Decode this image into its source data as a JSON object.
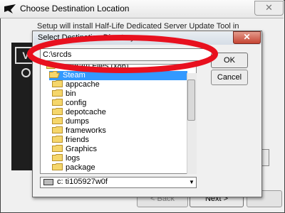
{
  "outer_window": {
    "title": "Choose Destination Location",
    "close_glyph": "✕",
    "subtitle_fragment": "Setup will install Half-Life Dedicated Server Update Tool in",
    "left_panel_glyph": "V",
    "buttons": {
      "back": "< Back",
      "next": "Next >",
      "cancel": ""
    }
  },
  "dialog": {
    "title": "Select Destination Directory",
    "close_glyph": "✕",
    "path_value": "C:\\srcds",
    "ok_label": "OK",
    "cancel_label": "Cancel",
    "tree": [
      {
        "label": "Program Files (x86)",
        "indent": 1,
        "selected": false,
        "open": true
      },
      {
        "label": "Steam",
        "indent": 1,
        "selected": true,
        "open": true
      },
      {
        "label": "appcache",
        "indent": 2,
        "selected": false,
        "open": false
      },
      {
        "label": "bin",
        "indent": 2,
        "selected": false,
        "open": false
      },
      {
        "label": "config",
        "indent": 2,
        "selected": false,
        "open": false
      },
      {
        "label": "depotcache",
        "indent": 2,
        "selected": false,
        "open": false
      },
      {
        "label": "dumps",
        "indent": 2,
        "selected": false,
        "open": false
      },
      {
        "label": "frameworks",
        "indent": 2,
        "selected": false,
        "open": false
      },
      {
        "label": "friends",
        "indent": 2,
        "selected": false,
        "open": false
      },
      {
        "label": "Graphics",
        "indent": 2,
        "selected": false,
        "open": false
      },
      {
        "label": "logs",
        "indent": 2,
        "selected": false,
        "open": false
      },
      {
        "label": "package",
        "indent": 2,
        "selected": false,
        "open": false
      }
    ],
    "drive_value": "c: ti105927w0f",
    "drive_arrow_glyph": "▼"
  },
  "colors": {
    "selection": "#3399ff",
    "folder_fill": "#f5d66b",
    "folder_stroke": "#b8902a",
    "annotation_oval": "#e8101e"
  }
}
